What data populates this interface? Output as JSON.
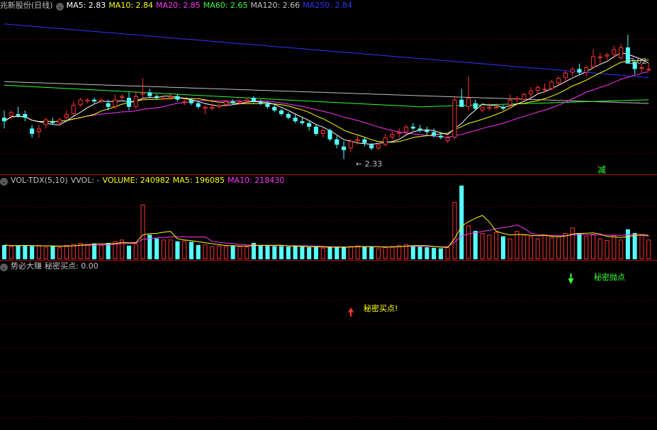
{
  "price_panel": {
    "title": "兆新股份(日线)",
    "indicators": [
      {
        "label": "MA5: 2.83",
        "color": "#ffffff"
      },
      {
        "label": "MA10: 2.84",
        "color": "#ffff00"
      },
      {
        "label": "MA20: 2.85",
        "color": "#ff33ff"
      },
      {
        "label": "MA60: 2.65",
        "color": "#33ff33"
      },
      {
        "label": "MA120: 2.66",
        "color": "#c0c0c0"
      },
      {
        "label": "MA250: 2.84",
        "color": "#3333ff"
      }
    ],
    "high_label": "3.02",
    "low_label": "2.33",
    "marker_label": "减"
  },
  "volume_panel": {
    "title": "VOL-TDX(5,10)",
    "items": [
      {
        "label": "VVOL: -",
        "color": "#c0c0c0"
      },
      {
        "label": "VOLUME: 240982",
        "color": "#ffff00"
      },
      {
        "label": "MA5: 196085",
        "color": "#ffff00"
      },
      {
        "label": "MA10: 218430",
        "color": "#ff33ff"
      }
    ]
  },
  "signal_panel": {
    "title": "势必大赚",
    "item": "秘密买点: 0.00",
    "buy_signal": "秘密买点!",
    "sell_signal": "秘密抛点"
  },
  "colors": {
    "up": "#ff3333",
    "down": "#55ffff",
    "grid": "#800000",
    "ma5": "#ffffff",
    "ma10": "#ffff00",
    "ma20": "#ff33ff",
    "ma60": "#33ff33",
    "ma120": "#c0c0c0",
    "ma250": "#3333ff"
  },
  "chart_data": {
    "type": "candlestick",
    "price_range": [
      2.25,
      3.15
    ],
    "candles": [
      [
        2.56,
        2.6,
        2.5,
        2.54
      ],
      [
        2.57,
        2.6,
        2.55,
        2.59
      ],
      [
        2.58,
        2.62,
        2.56,
        2.57
      ],
      [
        2.58,
        2.6,
        2.54,
        2.56
      ],
      [
        2.5,
        2.52,
        2.45,
        2.47
      ],
      [
        2.48,
        2.52,
        2.45,
        2.5
      ],
      [
        2.52,
        2.56,
        2.5,
        2.55
      ],
      [
        2.54,
        2.56,
        2.52,
        2.53
      ],
      [
        2.53,
        2.56,
        2.52,
        2.55
      ],
      [
        2.56,
        2.6,
        2.55,
        2.58
      ],
      [
        2.58,
        2.65,
        2.57,
        2.63
      ],
      [
        2.63,
        2.67,
        2.62,
        2.66
      ],
      [
        2.65,
        2.67,
        2.64,
        2.66
      ],
      [
        2.66,
        2.67,
        2.64,
        2.65
      ],
      [
        2.65,
        2.67,
        2.64,
        2.66
      ],
      [
        2.64,
        2.66,
        2.6,
        2.62
      ],
      [
        2.62,
        2.69,
        2.61,
        2.66
      ],
      [
        2.67,
        2.69,
        2.66,
        2.68
      ],
      [
        2.67,
        2.7,
        2.6,
        2.62
      ],
      [
        2.62,
        2.7,
        2.61,
        2.68
      ],
      [
        2.69,
        2.78,
        2.67,
        2.7
      ],
      [
        2.7,
        2.72,
        2.67,
        2.68
      ],
      [
        2.68,
        2.69,
        2.66,
        2.67
      ],
      [
        2.67,
        2.68,
        2.66,
        2.67
      ],
      [
        2.67,
        2.69,
        2.66,
        2.68
      ],
      [
        2.68,
        2.69,
        2.65,
        2.66
      ],
      [
        2.65,
        2.67,
        2.63,
        2.65
      ],
      [
        2.66,
        2.67,
        2.63,
        2.64
      ],
      [
        2.64,
        2.65,
        2.61,
        2.62
      ],
      [
        2.61,
        2.63,
        2.58,
        2.62
      ],
      [
        2.61,
        2.64,
        2.6,
        2.62
      ],
      [
        2.62,
        2.64,
        2.61,
        2.63
      ],
      [
        2.63,
        2.66,
        2.62,
        2.65
      ],
      [
        2.65,
        2.66,
        2.63,
        2.64
      ],
      [
        2.64,
        2.66,
        2.63,
        2.65
      ],
      [
        2.65,
        2.67,
        2.64,
        2.66
      ],
      [
        2.67,
        2.68,
        2.64,
        2.65
      ],
      [
        2.65,
        2.66,
        2.63,
        2.64
      ],
      [
        2.64,
        2.65,
        2.61,
        2.62
      ],
      [
        2.62,
        2.63,
        2.59,
        2.6
      ],
      [
        2.6,
        2.61,
        2.57,
        2.58
      ],
      [
        2.58,
        2.59,
        2.55,
        2.56
      ],
      [
        2.56,
        2.58,
        2.53,
        2.54
      ],
      [
        2.54,
        2.56,
        2.52,
        2.53
      ],
      [
        2.53,
        2.54,
        2.49,
        2.51
      ],
      [
        2.51,
        2.52,
        2.46,
        2.47
      ],
      [
        2.47,
        2.5,
        2.45,
        2.49
      ],
      [
        2.49,
        2.5,
        2.43,
        2.44
      ],
      [
        2.44,
        2.46,
        2.39,
        2.41
      ],
      [
        2.4,
        2.43,
        2.33,
        2.38
      ],
      [
        2.39,
        2.44,
        2.37,
        2.43
      ],
      [
        2.43,
        2.46,
        2.41,
        2.44
      ],
      [
        2.44,
        2.45,
        2.4,
        2.42
      ],
      [
        2.41,
        2.42,
        2.38,
        2.39
      ],
      [
        2.39,
        2.42,
        2.38,
        2.41
      ],
      [
        2.41,
        2.47,
        2.4,
        2.45
      ],
      [
        2.45,
        2.48,
        2.44,
        2.47
      ],
      [
        2.47,
        2.5,
        2.45,
        2.48
      ],
      [
        2.48,
        2.52,
        2.47,
        2.51
      ],
      [
        2.51,
        2.53,
        2.49,
        2.5
      ],
      [
        2.5,
        2.52,
        2.48,
        2.49
      ],
      [
        2.49,
        2.51,
        2.46,
        2.48
      ],
      [
        2.48,
        2.5,
        2.45,
        2.46
      ],
      [
        2.46,
        2.48,
        2.44,
        2.45
      ],
      [
        2.43,
        2.46,
        2.42,
        2.45
      ],
      [
        2.45,
        2.68,
        2.44,
        2.66
      ],
      [
        2.66,
        2.72,
        2.62,
        2.62
      ],
      [
        2.62,
        2.79,
        2.6,
        2.67
      ],
      [
        2.64,
        2.66,
        2.6,
        2.61
      ],
      [
        2.6,
        2.62,
        2.59,
        2.62
      ],
      [
        2.61,
        2.64,
        2.6,
        2.62
      ],
      [
        2.62,
        2.64,
        2.61,
        2.62
      ],
      [
        2.62,
        2.63,
        2.6,
        2.61
      ],
      [
        2.63,
        2.69,
        2.62,
        2.66
      ],
      [
        2.66,
        2.68,
        2.64,
        2.67
      ],
      [
        2.66,
        2.7,
        2.65,
        2.69
      ],
      [
        2.69,
        2.73,
        2.67,
        2.71
      ],
      [
        2.71,
        2.74,
        2.69,
        2.73
      ],
      [
        2.72,
        2.75,
        2.7,
        2.72
      ],
      [
        2.72,
        2.77,
        2.71,
        2.76
      ],
      [
        2.75,
        2.79,
        2.74,
        2.78
      ],
      [
        2.78,
        2.82,
        2.76,
        2.81
      ],
      [
        2.81,
        2.84,
        2.79,
        2.83
      ],
      [
        2.83,
        2.86,
        2.8,
        2.81
      ],
      [
        2.81,
        2.85,
        2.79,
        2.84
      ],
      [
        2.84,
        2.94,
        2.83,
        2.9
      ],
      [
        2.89,
        2.92,
        2.86,
        2.9
      ],
      [
        2.9,
        2.92,
        2.88,
        2.91
      ],
      [
        2.91,
        2.96,
        2.89,
        2.94
      ],
      [
        2.89,
        2.97,
        2.88,
        2.95
      ],
      [
        2.95,
        3.02,
        2.87,
        2.86
      ],
      [
        2.87,
        2.88,
        2.8,
        2.83
      ],
      [
        2.84,
        2.86,
        2.81,
        2.84
      ],
      [
        2.83,
        2.86,
        2.82,
        2.83
      ]
    ],
    "volumes": [
      0.26,
      0.24,
      0.25,
      0.26,
      0.24,
      0.25,
      0.23,
      0.24,
      0.22,
      0.26,
      0.28,
      0.3,
      0.27,
      0.29,
      0.26,
      0.3,
      0.33,
      0.36,
      0.25,
      0.29,
      1.0,
      0.45,
      0.38,
      0.36,
      0.36,
      0.33,
      0.34,
      0.32,
      0.26,
      0.27,
      0.24,
      0.25,
      0.24,
      0.25,
      0.24,
      0.23,
      0.3,
      0.26,
      0.25,
      0.24,
      0.24,
      0.23,
      0.24,
      0.23,
      0.22,
      0.23,
      0.21,
      0.22,
      0.23,
      0.22,
      0.24,
      0.25,
      0.23,
      0.23,
      0.2,
      0.22,
      0.24,
      0.26,
      0.28,
      0.25,
      0.23,
      0.22,
      0.21,
      0.2,
      0.22,
      1.05,
      1.35,
      0.62,
      0.52,
      0.48,
      0.45,
      0.5,
      0.42,
      0.38,
      0.52,
      0.45,
      0.42,
      0.38,
      0.44,
      0.4,
      0.42,
      0.48,
      0.58,
      0.48,
      0.42,
      0.46,
      0.38,
      0.35,
      0.44,
      0.36,
      0.55,
      0.48,
      0.44,
      0.36
    ],
    "volume_max": 1.35,
    "buy_signal_index": 49,
    "sell_signal_index": 83
  }
}
